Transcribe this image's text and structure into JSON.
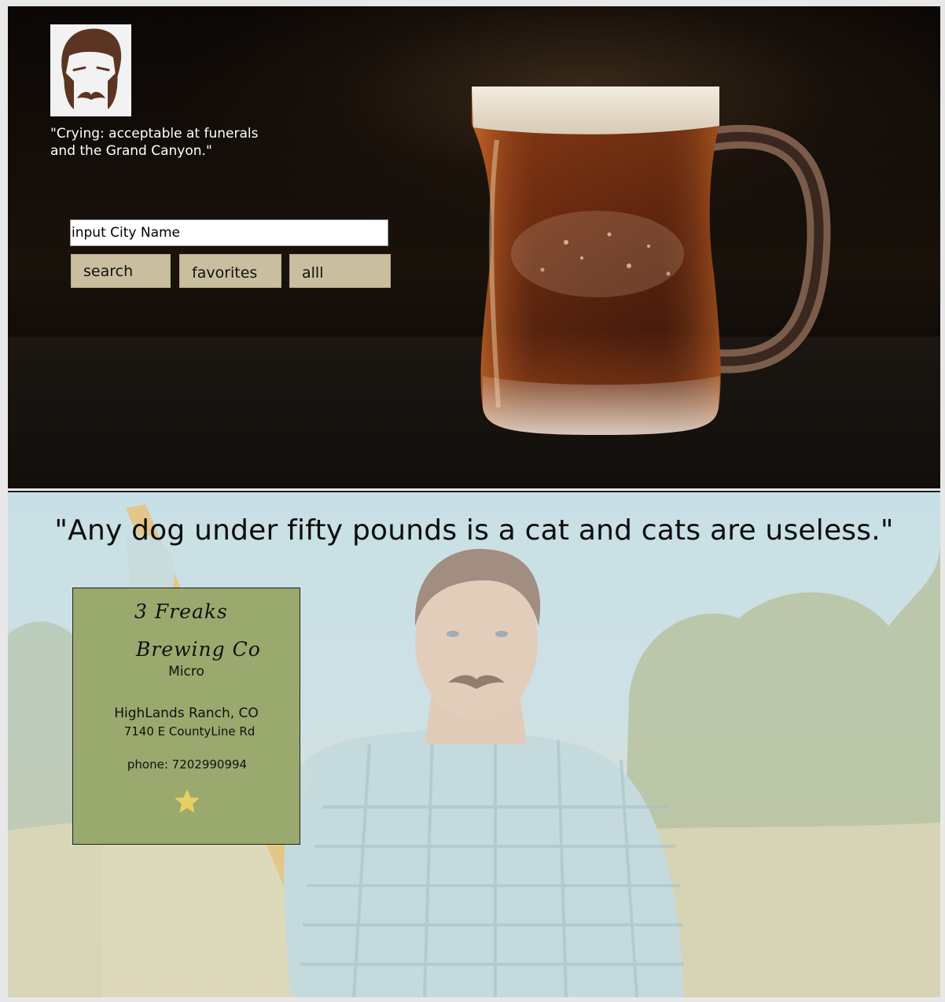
{
  "hero": {
    "quote": "\"Crying: acceptable at funerals and the Grand Canyon.\"",
    "search_placeholder": "input City Name",
    "buttons": {
      "search": "search",
      "favorites": "favorites",
      "all": "alll"
    }
  },
  "lower": {
    "quote": "\"Any dog under fifty pounds is a cat and cats are useless.\"",
    "brewery": {
      "name_line1": "3 Freaks",
      "name_line2": "Brewing Co",
      "type": "Micro",
      "city_state": "HighLands Ranch, CO",
      "street": "7140 E CountyLine Rd",
      "phone": "phone: 7202990994",
      "favorite": true
    }
  },
  "colors": {
    "button_bg": "#c9bf9f",
    "card_bg": "#9aa96d",
    "star": "#e6cf63"
  },
  "icons": {
    "avatar": "mustache-man-icon",
    "favorite": "star-icon"
  }
}
